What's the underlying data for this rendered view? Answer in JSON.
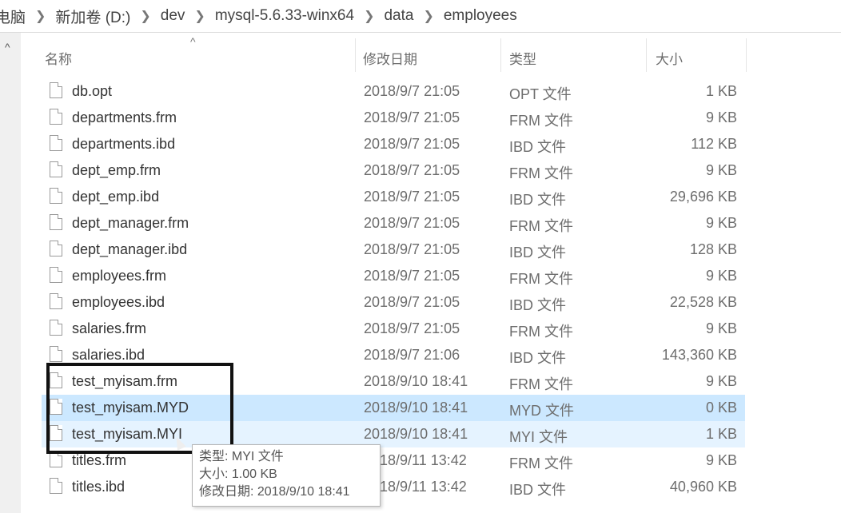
{
  "breadcrumb": [
    "电脑",
    "新加卷 (D:)",
    "dev",
    "mysql-5.6.33-winx64",
    "data",
    "employees"
  ],
  "columns": {
    "name": "名称",
    "date": "修改日期",
    "type": "类型",
    "size": "大小"
  },
  "files": [
    {
      "name": "db.opt",
      "date": "2018/9/7 21:05",
      "type": "OPT 文件",
      "size": "1 KB"
    },
    {
      "name": "departments.frm",
      "date": "2018/9/7 21:05",
      "type": "FRM 文件",
      "size": "9 KB"
    },
    {
      "name": "departments.ibd",
      "date": "2018/9/7 21:05",
      "type": "IBD 文件",
      "size": "112 KB"
    },
    {
      "name": "dept_emp.frm",
      "date": "2018/9/7 21:05",
      "type": "FRM 文件",
      "size": "9 KB"
    },
    {
      "name": "dept_emp.ibd",
      "date": "2018/9/7 21:05",
      "type": "IBD 文件",
      "size": "29,696 KB"
    },
    {
      "name": "dept_manager.frm",
      "date": "2018/9/7 21:05",
      "type": "FRM 文件",
      "size": "9 KB"
    },
    {
      "name": "dept_manager.ibd",
      "date": "2018/9/7 21:05",
      "type": "IBD 文件",
      "size": "128 KB"
    },
    {
      "name": "employees.frm",
      "date": "2018/9/7 21:05",
      "type": "FRM 文件",
      "size": "9 KB"
    },
    {
      "name": "employees.ibd",
      "date": "2018/9/7 21:05",
      "type": "IBD 文件",
      "size": "22,528 KB"
    },
    {
      "name": "salaries.frm",
      "date": "2018/9/7 21:05",
      "type": "FRM 文件",
      "size": "9 KB"
    },
    {
      "name": "salaries.ibd",
      "date": "2018/9/7 21:06",
      "type": "IBD 文件",
      "size": "143,360 KB"
    },
    {
      "name": "test_myisam.frm",
      "date": "2018/9/10 18:41",
      "type": "FRM 文件",
      "size": "9 KB"
    },
    {
      "name": "test_myisam.MYD",
      "date": "2018/9/10 18:41",
      "type": "MYD 文件",
      "size": "0 KB",
      "state": "selected"
    },
    {
      "name": "test_myisam.MYI",
      "date": "2018/9/10 18:41",
      "type": "MYI 文件",
      "size": "1 KB",
      "state": "hovered"
    },
    {
      "name": "titles.frm",
      "date": "2018/9/11 13:42",
      "type": "FRM 文件",
      "size": "9 KB"
    },
    {
      "name": "titles.ibd",
      "date": "2018/9/11 13:42",
      "type": "IBD 文件",
      "size": "40,960 KB"
    }
  ],
  "tooltip": {
    "type_line": "类型: MYI 文件",
    "size_line": "大小: 1.00 KB",
    "date_line": "修改日期: 2018/9/10 18:41"
  },
  "colors": {
    "selected_row": "#cce8ff",
    "hovered_row": "#e5f3ff",
    "highlight_box": "#111111"
  }
}
